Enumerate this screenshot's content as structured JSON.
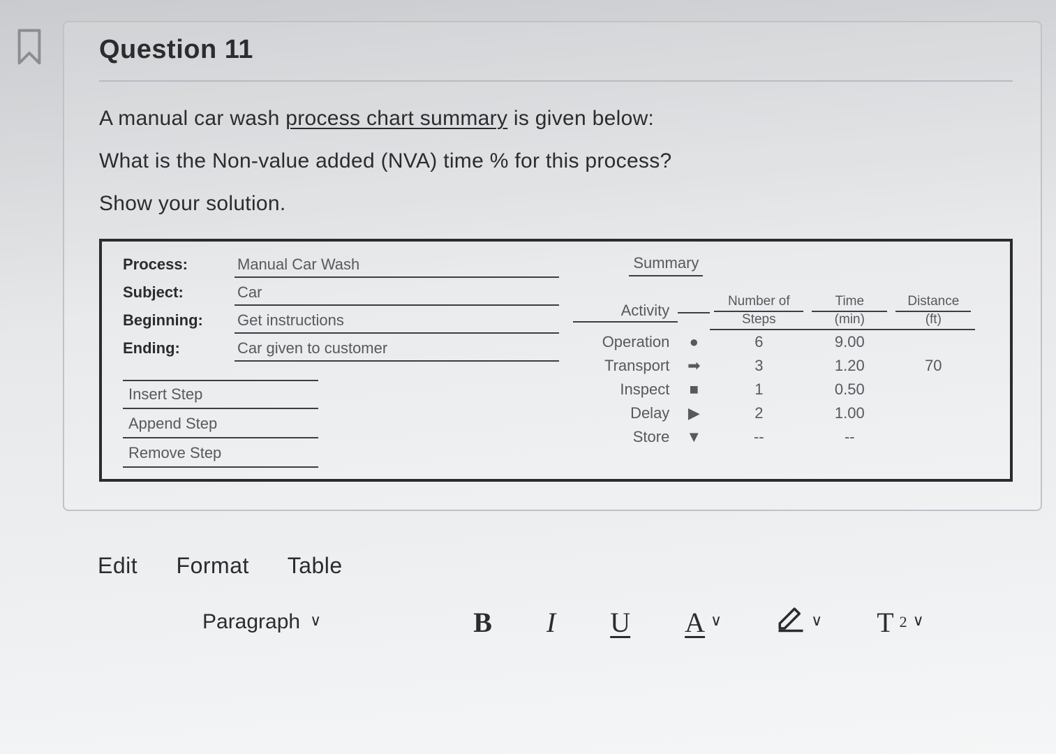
{
  "question": {
    "title": "Question 11",
    "line1_a": "A manual car wash ",
    "line1_u": "process chart summary",
    "line1_b": " is given below:",
    "line2": "What is the Non-value added (NVA) time % for this process?",
    "line3": "Show your solution."
  },
  "chart": {
    "meta": {
      "process_label": "Process:",
      "process_value": "Manual Car Wash",
      "subject_label": "Subject:",
      "subject_value": "Car",
      "beginning_label": "Beginning:",
      "beginning_value": "Get instructions",
      "ending_label": "Ending:",
      "ending_value": "Car given to customer"
    },
    "buttons": {
      "insert": "Insert Step",
      "append": "Append Step",
      "remove": "Remove Step"
    },
    "summary": {
      "title": "Summary",
      "head": {
        "activity": "Activity",
        "num1": "Number of",
        "num2": "Steps",
        "time1": "Time",
        "time2": "(min)",
        "dist1": "Distance",
        "dist2": "(ft)"
      },
      "rows": [
        {
          "activity": "Operation",
          "icon": "●",
          "steps": "6",
          "time": "9.00",
          "dist": ""
        },
        {
          "activity": "Transport",
          "icon": "➡",
          "steps": "3",
          "time": "1.20",
          "dist": "70"
        },
        {
          "activity": "Inspect",
          "icon": "■",
          "steps": "1",
          "time": "0.50",
          "dist": ""
        },
        {
          "activity": "Delay",
          "icon": "▶",
          "steps": "2",
          "time": "1.00",
          "dist": ""
        },
        {
          "activity": "Store",
          "icon": "▼",
          "steps": "--",
          "time": "--",
          "dist": ""
        }
      ]
    }
  },
  "chart_data": {
    "type": "table",
    "title": "Process chart summary — Manual Car Wash",
    "columns": [
      "Activity",
      "Number of Steps",
      "Time (min)",
      "Distance (ft)"
    ],
    "rows": [
      [
        "Operation",
        6,
        9.0,
        null
      ],
      [
        "Transport",
        3,
        1.2,
        70
      ],
      [
        "Inspect",
        1,
        0.5,
        null
      ],
      [
        "Delay",
        2,
        1.0,
        null
      ],
      [
        "Store",
        null,
        null,
        null
      ]
    ]
  },
  "editor": {
    "menu": {
      "edit": "Edit",
      "format": "Format",
      "table": "Table"
    },
    "paragraph": "Paragraph",
    "bold": "B",
    "italic": "I",
    "underline": "U",
    "textcolor": "A",
    "superscript_base": "T",
    "superscript_exp": "2",
    "chevron": "∨"
  }
}
